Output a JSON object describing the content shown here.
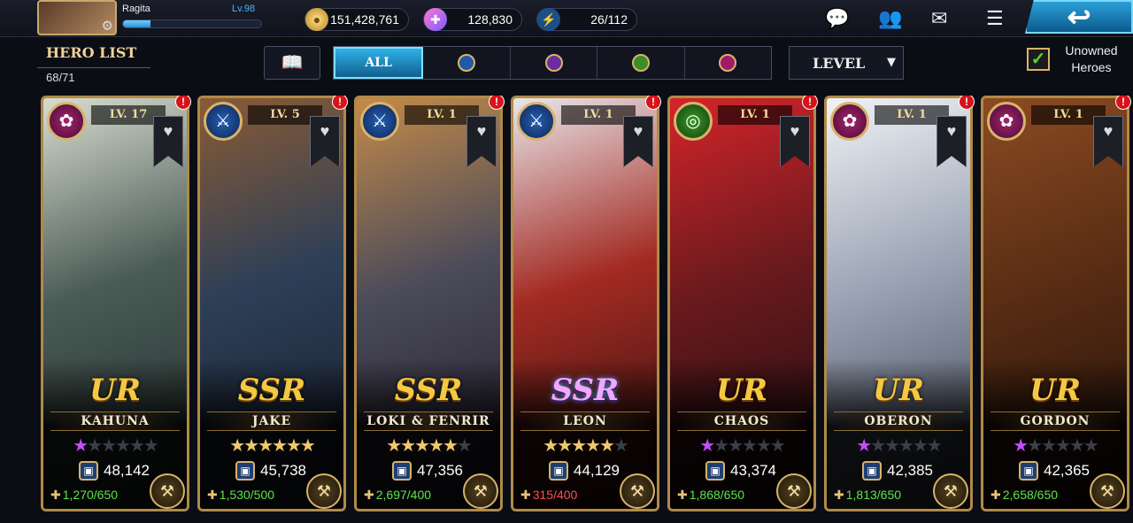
{
  "player": {
    "name": "Ragita",
    "level": "Lv.98",
    "xp_fraction": 0.2
  },
  "resources": [
    {
      "name": "gold",
      "icon": "gold-coin-icon",
      "value": "151,428,761"
    },
    {
      "name": "crystals",
      "icon": "crystal-icon",
      "value": "128,830"
    },
    {
      "name": "stamina",
      "icon": "lightning-icon",
      "value": "26/112"
    }
  ],
  "header": {
    "title": "HERO LIST",
    "count": "68/71"
  },
  "filters": {
    "all_label": "ALL",
    "elements": [
      "water-element-icon",
      "shadow-element-icon",
      "nature-element-icon",
      "arcane-element-icon"
    ]
  },
  "sort": {
    "label": "LEVEL"
  },
  "unowned": {
    "label": "Unowned Heroes",
    "checked": true
  },
  "heroes": [
    {
      "name": "KAHUNA",
      "level": "LV. 17",
      "rarity": "UR",
      "element": "arcane",
      "stars_on": 1,
      "stars_type": "awaken",
      "power": "48,142",
      "shards": "1,270/650",
      "shard_ok": true,
      "art": [
        "#d7dccf",
        "#4b5c56",
        "#1d2a2a"
      ]
    },
    {
      "name": "JAKE",
      "level": "LV. 5",
      "rarity": "SSR",
      "element": "water",
      "stars_on": 6,
      "stars_type": "gold",
      "power": "45,738",
      "shards": "1,530/500",
      "shard_ok": true,
      "art": [
        "#8a5b35",
        "#2d3f57",
        "#161c2a"
      ]
    },
    {
      "name": "LOKI & FENRIR",
      "level": "LV. 1",
      "rarity": "SSR",
      "element": "water",
      "stars_on": 5,
      "stars_type": "gold",
      "power": "47,356",
      "shards": "2,697/400",
      "shard_ok": true,
      "art": [
        "#c48a49",
        "#4b4b5a",
        "#1f1a2a"
      ]
    },
    {
      "name": "LEON",
      "level": "LV. 1",
      "rarity": "SSR",
      "element": "water",
      "stars_on": 5,
      "stars_type": "gold",
      "power": "44,129",
      "shards": "315/400",
      "shard_ok": false,
      "art": [
        "#e9e6ea",
        "#a32b23",
        "#2a0d0d"
      ]
    },
    {
      "name": "CHAOS",
      "level": "LV. 1",
      "rarity": "UR",
      "element": "nature",
      "stars_on": 1,
      "stars_type": "awaken",
      "power": "43,374",
      "shards": "1,868/650",
      "shard_ok": true,
      "art": [
        "#d4242a",
        "#6a1a1d",
        "#1a0c10"
      ]
    },
    {
      "name": "OBERON",
      "level": "LV. 1",
      "rarity": "UR",
      "element": "arcane",
      "stars_on": 1,
      "stars_type": "awaken",
      "power": "42,385",
      "shards": "1,813/650",
      "shard_ok": true,
      "art": [
        "#f0f2f5",
        "#9aa3b4",
        "#3a3f4f"
      ]
    },
    {
      "name": "GORDON",
      "level": "LV. 1",
      "rarity": "UR",
      "element": "arcane",
      "stars_on": 1,
      "stars_type": "awaken",
      "power": "42,365",
      "shards": "2,658/650",
      "shard_ok": true,
      "art": [
        "#8b4b23",
        "#5a2d14",
        "#1e0f08"
      ]
    }
  ],
  "colors": {
    "gold": "#f5c842",
    "accent": "#2fb1e8",
    "shard_ok": "#5fe34a",
    "shard_low": "#ff4d4d"
  }
}
